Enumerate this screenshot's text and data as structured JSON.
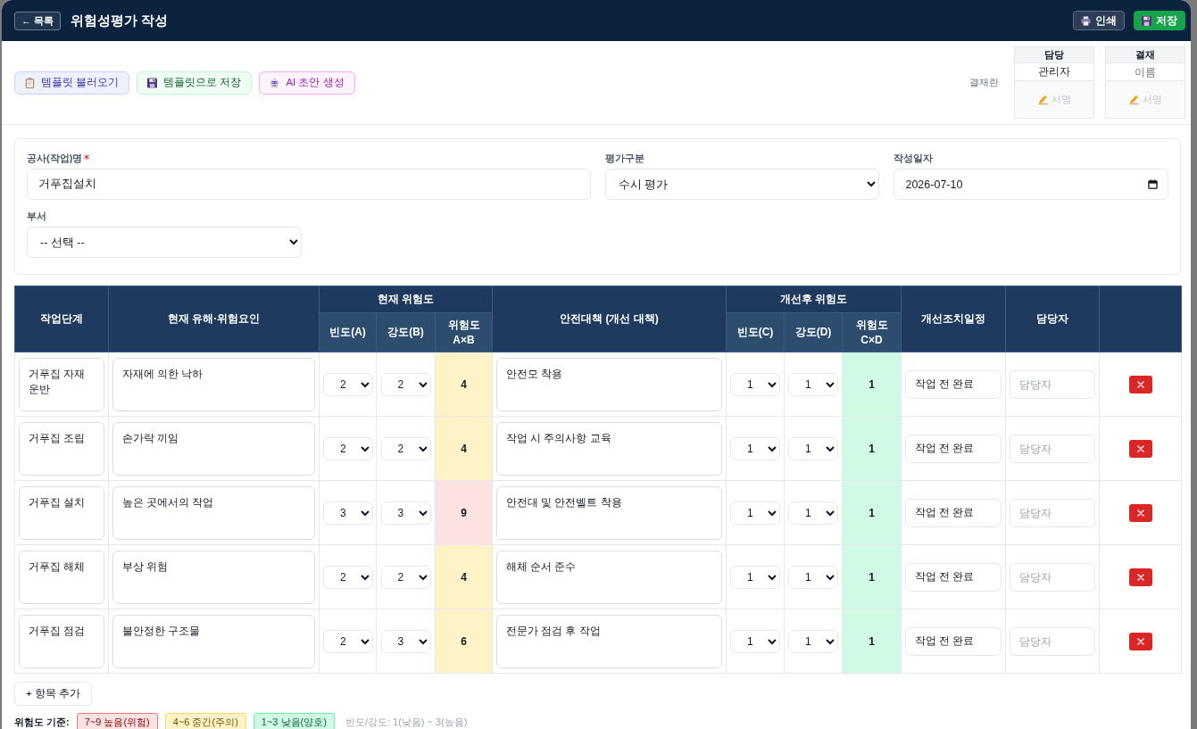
{
  "header": {
    "back_button": "← 목록",
    "title": "위험성평가 작성",
    "actions": [
      {
        "label": "인쇄",
        "kind": "print"
      },
      {
        "label": "저장",
        "kind": "save"
      }
    ]
  },
  "toolbar": {
    "buttons": [
      {
        "label": "템플릿 불러오기",
        "kind": "load"
      },
      {
        "label": "템플릿으로 저장",
        "kind": "save"
      },
      {
        "label": "AI 초안 생성",
        "kind": "ai"
      }
    ]
  },
  "approval": {
    "label": "결재란",
    "slots": [
      {
        "role": "담당",
        "name": {
          "value": "관리자"
        },
        "sign_label": "서명"
      },
      {
        "role": "결재",
        "name": {
          "placeholder": "이름"
        },
        "sign_label": "서명"
      }
    ]
  },
  "form": {
    "fields": [
      {
        "label": "공사(작업)명",
        "required": true,
        "kind": "text",
        "value": "거푸집설치"
      },
      {
        "label": "평가구분",
        "required": false,
        "kind": "select",
        "value": "수시 평가"
      },
      {
        "label": "작성일자",
        "required": false,
        "kind": "date",
        "value": "2026-07-10"
      },
      {
        "label": "부서",
        "required": false,
        "kind": "select",
        "value": "-- 선택 --"
      }
    ]
  },
  "table": {
    "columns": [
      {
        "label": "작업단계"
      },
      {
        "label": "현재 유해·위험요인"
      },
      {
        "group": "현재 위험도",
        "children": [
          {
            "label": "빈도(A)"
          },
          {
            "label": "강도(B)"
          },
          {
            "label": "위험도 A×B"
          }
        ]
      },
      {
        "label": "안전대책 (개선 대책)"
      },
      {
        "group": "개선후 위험도",
        "children": [
          {
            "label": "빈도(C)"
          },
          {
            "label": "강도(D)"
          },
          {
            "label": "위험도 C×D"
          }
        ]
      },
      {
        "label": "개선조치일정"
      },
      {
        "label": "담당자"
      }
    ],
    "rows": [
      {
        "step": "거푸집 자재 운반",
        "hazard": "자재에 의한 낙하",
        "current": {
          "frequency": "2",
          "severity": "2",
          "risk": "4",
          "color": "#fef3c7"
        },
        "measure": "안전모 착용",
        "after": {
          "frequency": "1",
          "severity": "1",
          "risk": "1",
          "color": "#d1fae5"
        },
        "schedule": "작업 전 완료",
        "owner": {
          "placeholder": "담당자"
        }
      },
      {
        "step": "거푸집 조립",
        "hazard": "손가락 끼임",
        "current": {
          "frequency": "2",
          "severity": "2",
          "risk": "4",
          "color": "#fef3c7"
        },
        "measure": "작업 시 주의사항 교육",
        "after": {
          "frequency": "1",
          "severity": "1",
          "risk": "1",
          "color": "#d1fae5"
        },
        "schedule": "작업 전 완료",
        "owner": {
          "placeholder": "담당자"
        }
      },
      {
        "step": "거푸집 설치",
        "hazard": "높은 곳에서의 작업",
        "current": {
          "frequency": "3",
          "severity": "3",
          "risk": "9",
          "color": "#fde2e4"
        },
        "measure": "안전대 및 안전벨트 착용",
        "after": {
          "frequency": "1",
          "severity": "1",
          "risk": "1",
          "color": "#d1fae5"
        },
        "schedule": "작업 전 완료",
        "owner": {
          "placeholder": "담당자"
        }
      },
      {
        "step": "거푸집 해체",
        "hazard": "부상 위험",
        "current": {
          "frequency": "2",
          "severity": "2",
          "risk": "4",
          "color": "#fef3c7"
        },
        "measure": "해체 순서 준수",
        "after": {
          "frequency": "1",
          "severity": "1",
          "risk": "1",
          "color": "#d1fae5"
        },
        "schedule": "작업 전 완료",
        "owner": {
          "placeholder": "담당자"
        }
      },
      {
        "step": "거푸집 점검",
        "hazard": "불안정한 구조물",
        "current": {
          "frequency": "2",
          "severity": "3",
          "risk": "6",
          "color": "#fef3c7"
        },
        "measure": "전문가 점검 후 작업",
        "after": {
          "frequency": "1",
          "severity": "1",
          "risk": "1",
          "color": "#d1fae5"
        },
        "schedule": "작업 전 완료",
        "owner": {
          "placeholder": "담당자"
        }
      }
    ]
  },
  "add_button": "+ 항목 추가",
  "legend": {
    "title": "위험도 기준:",
    "items": [
      {
        "label": "7~9 높음(위험)",
        "color": "#fee2e2"
      },
      {
        "label": "4~6 중간(주의)",
        "color": "#fef3c7"
      },
      {
        "label": "1~3 낮음(양호)",
        "color": "#d1fae5"
      }
    ],
    "note": "빈도/강도: 1(낮음) ~ 3(높음)"
  }
}
